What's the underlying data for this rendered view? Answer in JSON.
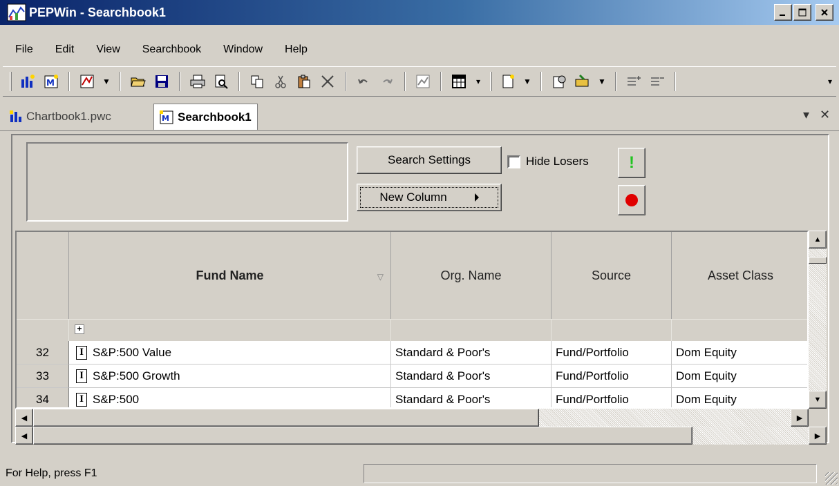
{
  "window": {
    "title": "PEPWin - Searchbook1"
  },
  "menu": [
    "File",
    "Edit",
    "View",
    "Searchbook",
    "Window",
    "Help"
  ],
  "tabs": {
    "inactive": "Chartbook1.pwc",
    "active": "Searchbook1"
  },
  "controls": {
    "search_settings": "Search Settings",
    "new_column": "New Column",
    "hide_losers": "Hide Losers",
    "run_symbol": "!"
  },
  "table": {
    "headers": [
      "Fund Name",
      "Org. Name",
      "Source",
      "Asset Class"
    ],
    "rows": [
      {
        "num": "32",
        "icon": "I",
        "fund": "S&P:500 Value",
        "org": "Standard & Poor's",
        "source": "Fund/Portfolio",
        "asset": "Dom Equity"
      },
      {
        "num": "33",
        "icon": "I",
        "fund": "S&P:500 Growth",
        "org": "Standard & Poor's",
        "source": "Fund/Portfolio",
        "asset": "Dom Equity"
      },
      {
        "num": "34",
        "icon": "I",
        "fund": "S&P:500",
        "org": "Standard & Poor's",
        "source": "Fund/Portfolio",
        "asset": "Dom Equity"
      }
    ]
  },
  "status": {
    "help_text": "For Help, press F1"
  },
  "colors": {
    "title_start": "#0a246a",
    "title_end": "#a6caf0",
    "record": "#e00000",
    "run": "#22c322"
  }
}
